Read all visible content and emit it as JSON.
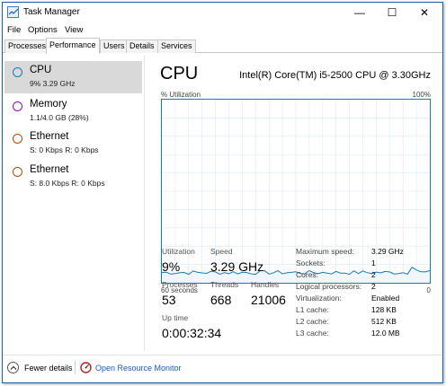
{
  "window": {
    "title": "Task Manager"
  },
  "titlebar_buttons": {
    "minimize": "—",
    "maximize": "☐",
    "close": "✕"
  },
  "menu": [
    "File",
    "Options",
    "View"
  ],
  "tabs": [
    {
      "label": "Processes",
      "active": false
    },
    {
      "label": "Performance",
      "active": true
    },
    {
      "label": "Users",
      "active": false
    },
    {
      "label": "Details",
      "active": false
    },
    {
      "label": "Services",
      "active": false
    }
  ],
  "sidebar": {
    "items": [
      {
        "name": "CPU",
        "sub": "9% 3.29 GHz",
        "color": "#117dbb",
        "active": true
      },
      {
        "name": "Memory",
        "sub": "1.1/4.0 GB (28%)",
        "color": "#8b12ae",
        "active": false
      },
      {
        "name": "Ethernet",
        "sub": "S: 0 Kbps  R: 0 Kbps",
        "color": "#a74f01",
        "active": false
      },
      {
        "name": "Ethernet",
        "sub": "S: 8.0 Kbps  R: 0 Kbps",
        "color": "#a74f01",
        "active": false
      }
    ]
  },
  "main": {
    "heading": "CPU",
    "model": "Intel(R) Core(TM) i5-2500 CPU @ 3.30GHz",
    "graph": {
      "y_label": "% Utilization",
      "y_max": "100%",
      "x_left": "60 seconds",
      "x_right": "0",
      "line_color": "#117dbb",
      "fill_color": "#f1f6fa",
      "grid_color": "#d9eaf4"
    },
    "stats": {
      "utilization_label": "Utilization",
      "utilization_value": "9%",
      "speed_label": "Speed",
      "speed_value": "3.29 GHz",
      "processes_label": "Processes",
      "processes_value": "53",
      "threads_label": "Threads",
      "threads_value": "668",
      "handles_label": "Handles",
      "handles_value": "21006",
      "uptime_label": "Up time",
      "uptime_value": "0:00:32:34"
    },
    "info": [
      {
        "key": "Maximum speed:",
        "value": "3.29 GHz"
      },
      {
        "key": "Sockets:",
        "value": "1"
      },
      {
        "key": "Cores:",
        "value": "2"
      },
      {
        "key": "Logical processors:",
        "value": "2"
      },
      {
        "key": "Virtualization:",
        "value": "Enabled"
      },
      {
        "key": "L1 cache:",
        "value": "128 KB"
      },
      {
        "key": "L2 cache:",
        "value": "512 KB"
      },
      {
        "key": "L3 cache:",
        "value": "12.0 MB"
      }
    ]
  },
  "footer": {
    "fewer_details": "Fewer details",
    "open_resource_monitor": "Open Resource Monitor"
  }
}
